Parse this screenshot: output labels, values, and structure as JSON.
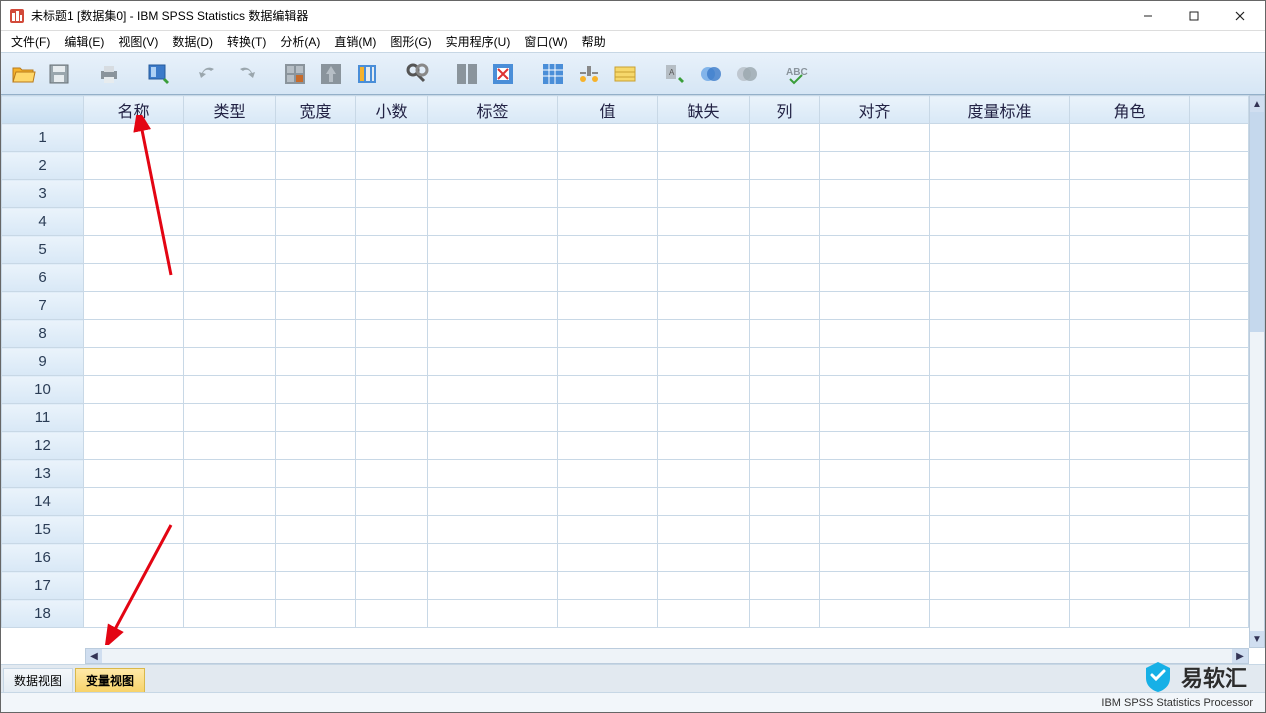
{
  "window": {
    "title": "未标题1 [数据集0] - IBM SPSS Statistics 数据编辑器"
  },
  "menu": {
    "file": "文件(F)",
    "edit": "编辑(E)",
    "view": "视图(V)",
    "data": "数据(D)",
    "transform": "转换(T)",
    "analyze": "分析(A)",
    "direct": "直销(M)",
    "graph": "图形(G)",
    "util": "实用程序(U)",
    "window": "窗口(W)",
    "help": "帮助"
  },
  "columns": {
    "name": "名称",
    "type": "类型",
    "width": "宽度",
    "decimals": "小数",
    "label": "标签",
    "value": "值",
    "missing": "缺失",
    "col": "列",
    "align": "对齐",
    "measure": "度量标准",
    "role": "角色"
  },
  "row_count": 18,
  "tabs": {
    "data_view": "数据视图",
    "variable_view": "变量视图"
  },
  "status": {
    "processor": "IBM SPSS Statistics Processor"
  },
  "watermark": {
    "text": "易软汇"
  }
}
